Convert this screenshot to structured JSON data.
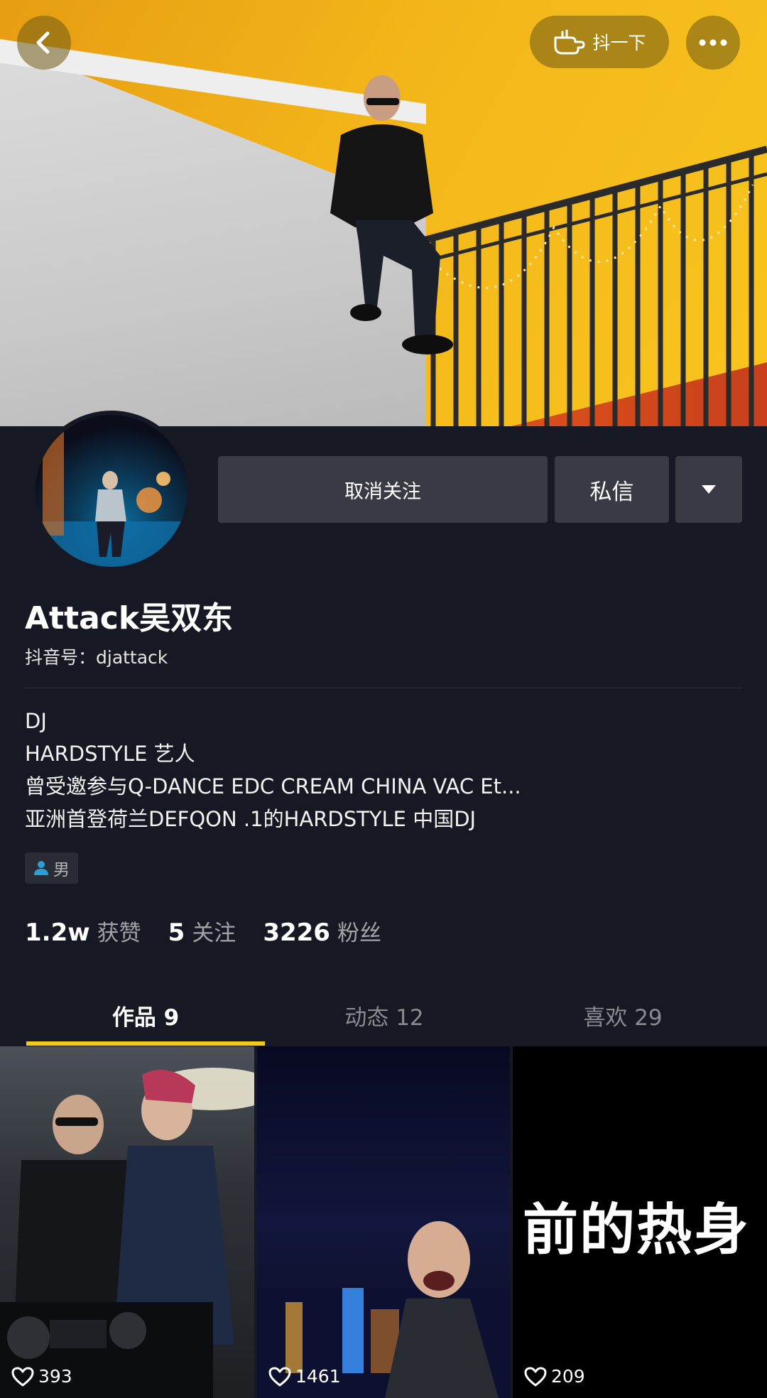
{
  "header": {
    "shake_label": "抖一下"
  },
  "profile": {
    "unfollow_label": "取消关注",
    "message_label": "私信",
    "nickname": "Attack吴双东",
    "account_id": "抖音号：djattack",
    "bio": [
      "DJ",
      "HARDSTYLE 艺人",
      "曾受邀参与Q-DANCE EDC CREAM CHINA VAC Et...",
      "亚洲首登荷兰DEFQON .1的HARDSTYLE 中国DJ"
    ],
    "gender": "男"
  },
  "stats": {
    "likes_num": "1.2w",
    "likes_label": "获赞",
    "following_num": "5",
    "following_label": "关注",
    "followers_num": "3226",
    "followers_label": "粉丝"
  },
  "tabs": [
    "作品 9",
    "动态 12",
    "喜欢 29"
  ],
  "videos": [
    {
      "likes": "393"
    },
    {
      "likes": "1461"
    },
    {
      "likes": "209",
      "overlay_text": "前的热身"
    }
  ],
  "colors": {
    "background": "#161823",
    "tab_indicator": "#f4c91b",
    "button": "#393b44"
  },
  "icons": [
    "back-arrow-icon",
    "hand-shake-icon",
    "more-dots-icon",
    "dropdown-triangle-icon",
    "person-icon",
    "heart-icon"
  ]
}
